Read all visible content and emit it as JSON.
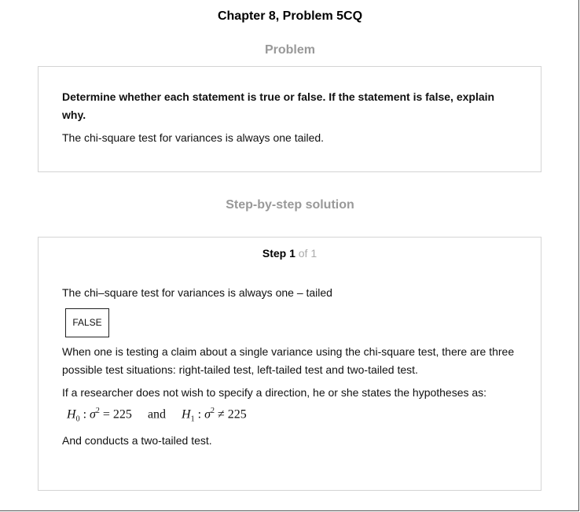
{
  "header": {
    "chapter_title": "Chapter 8, Problem 5CQ"
  },
  "problem": {
    "section_title": "Problem",
    "instruction": "Determine whether each statement is true or false. If the statement is false, explain why.",
    "statement": "The chi-square test for variances is always one tailed."
  },
  "solution": {
    "section_title": "Step-by-step solution",
    "step_label": "Step 1",
    "step_of": "of 1",
    "restatement": "The chi–square test for variances is always one – tailed",
    "answer": "FALSE",
    "explanation": "When one is testing a claim about a single variance using the chi-square test, there are three possible test situations: right-tailed test, left-tailed test and two-tailed test.",
    "hypothesis_intro": "If a researcher does not wish to specify a direction, he or she states the hypotheses as:",
    "formula": {
      "h0_symbol": "H",
      "h0_sub": "0",
      "sigma": "σ",
      "exp": "2",
      "h0_rel": "= 225",
      "and": "and",
      "h1_symbol": "H",
      "h1_sub": "1",
      "h1_rel": "≠ 225"
    },
    "conclusion": "And conducts a two-tailed test."
  }
}
